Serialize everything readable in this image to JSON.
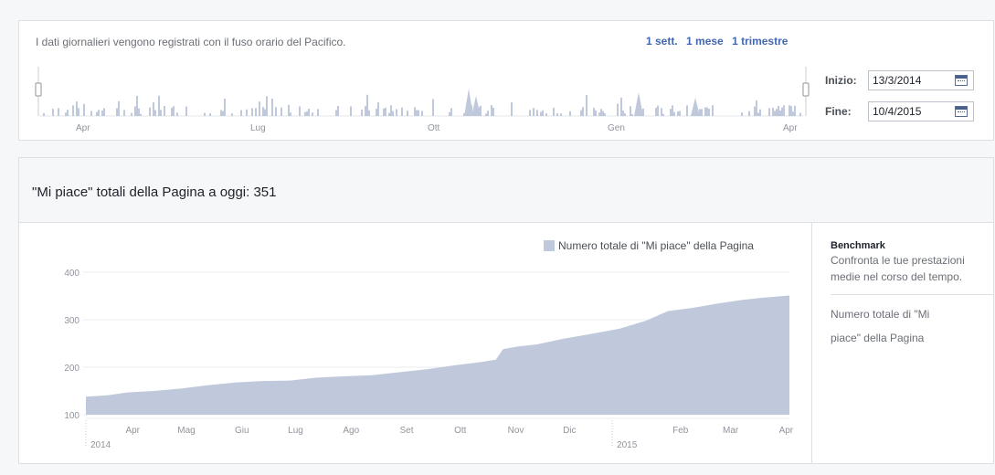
{
  "range_selector": {
    "note": "I dati giornalieri vengono registrati con il fuso orario del Pacifico.",
    "presets": [
      "1 sett.",
      "1 mese",
      "1 trimestre"
    ],
    "overview_months": [
      "Apr",
      "Lug",
      "Ott",
      "Gen",
      "Apr"
    ],
    "start_label": "Inizio:",
    "start_value": "13/3/2014",
    "end_label": "Fine:",
    "end_value": "10/4/2015"
  },
  "metric": {
    "title": "\"Mi piace\" totali della Pagina a oggi: 351",
    "legend": "Numero totale di \"Mi piace\" della Pagina"
  },
  "benchmark": {
    "title": "Benchmark",
    "text": "Confronta le tue prestazioni medie nel corso del tempo.",
    "link_line1": "Numero totale di \"Mi",
    "link_line2": "piace\" della Pagina"
  },
  "colors": {
    "area_fill": "#c0c8db",
    "link": "#4267b2",
    "border": "#dddfe2"
  },
  "chart_data": {
    "type": "area",
    "series": [
      {
        "name": "Numero totale di \"Mi piace\" della Pagina"
      }
    ],
    "x": [
      "2014-03-13",
      "2014-03-25",
      "2014-04-05",
      "2014-04-20",
      "2014-05-05",
      "2014-05-20",
      "2014-06-05",
      "2014-06-20",
      "2014-07-05",
      "2014-07-20",
      "2014-08-05",
      "2014-08-20",
      "2014-09-05",
      "2014-09-20",
      "2014-10-05",
      "2014-10-20",
      "2014-10-28",
      "2014-11-01",
      "2014-11-10",
      "2014-11-20",
      "2014-12-05",
      "2014-12-20",
      "2015-01-05",
      "2015-01-20",
      "2015-02-01",
      "2015-02-15",
      "2015-03-01",
      "2015-03-15",
      "2015-03-25",
      "2015-04-10"
    ],
    "values": [
      138,
      141,
      147,
      150,
      155,
      162,
      168,
      171,
      172,
      178,
      181,
      183,
      190,
      196,
      204,
      211,
      216,
      238,
      244,
      248,
      260,
      270,
      281,
      298,
      318,
      325,
      334,
      342,
      346,
      351
    ],
    "yticks": [
      100,
      200,
      300,
      400
    ],
    "ylim": [
      100,
      400
    ],
    "x_tick_labels": [
      "Apr",
      "Mag",
      "Giu",
      "Lug",
      "Ago",
      "Set",
      "Ott",
      "Nov",
      "Dic",
      "Feb",
      "Mar",
      "Apr"
    ],
    "year_labels": [
      "2014",
      "2015"
    ],
    "grid": true,
    "legend_position": "top-right"
  }
}
